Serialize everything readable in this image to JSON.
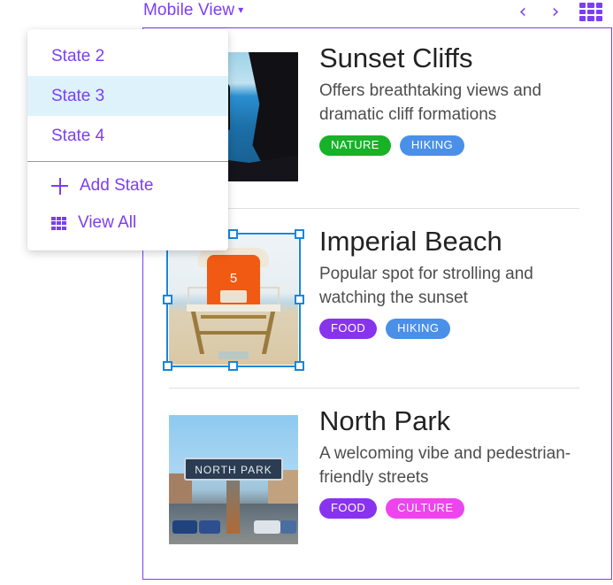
{
  "topbar": {
    "view_title": "Mobile View",
    "caret": "▾",
    "prev_icon": "‹",
    "next_icon": "›",
    "grid_icon": "grid-icon",
    "accent_color": "#7B3FF2"
  },
  "dropdown": {
    "items": [
      {
        "label": "State 2",
        "selected": false
      },
      {
        "label": "State 3",
        "selected": true
      },
      {
        "label": "State 4",
        "selected": false
      }
    ],
    "actions": [
      {
        "label": "Add State",
        "icon": "plus-icon"
      },
      {
        "label": "View All",
        "icon": "grid-icon"
      }
    ],
    "selected_bg": "#ddf2fb"
  },
  "cards": [
    {
      "title": "Sunset Cliffs",
      "description": "Offers breathtaking views and dramatic cliff formations",
      "image_alt": "sunset-cliffs-photo",
      "tags": [
        {
          "label": "NATURE",
          "color": "#17b227"
        },
        {
          "label": "HIKING",
          "color": "#4a90e8"
        }
      ],
      "selected": false
    },
    {
      "title": "Imperial Beach",
      "description": "Popular spot for strolling and watching the sunset",
      "image_alt": "imperial-beach-lifeguard-tower-photo",
      "tower_number": "5",
      "tags": [
        {
          "label": "FOOD",
          "color": "#8833ee"
        },
        {
          "label": "HIKING",
          "color": "#4a90e8"
        }
      ],
      "selected": true
    },
    {
      "title": "North Park",
      "description": "A welcoming vibe and pedestrian-friendly streets",
      "image_alt": "north-park-sign-photo",
      "sign_text": "NORTH PARK",
      "tags": [
        {
          "label": "FOOD",
          "color": "#8833ee"
        },
        {
          "label": "CULTURE",
          "color": "#ee44ee"
        }
      ],
      "selected": false
    }
  ],
  "selection": {
    "handle_color": "#1a86d8",
    "target": "imperial-beach-image"
  }
}
